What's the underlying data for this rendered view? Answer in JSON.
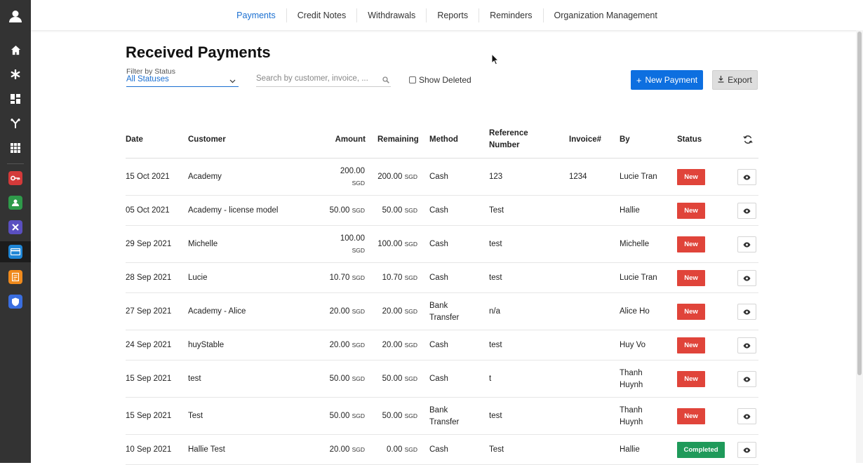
{
  "sidebar": {
    "icons": [
      "avatar-icon",
      "home-icon",
      "asterisk-icon",
      "dashboard-icon",
      "branch-icon",
      "grid-icon"
    ],
    "apps": [
      {
        "name": "key-app-icon",
        "color": "#d43a3a"
      },
      {
        "name": "people-app-icon",
        "color": "#2e9a4a"
      },
      {
        "name": "tools-app-icon",
        "color": "#5a4fc0"
      },
      {
        "name": "payment-app-icon",
        "color": "#1f86d6"
      },
      {
        "name": "notes-app-icon",
        "color": "#f08a1c"
      },
      {
        "name": "shield-app-icon",
        "color": "#3a6ee0"
      }
    ]
  },
  "nav": {
    "items": [
      "Payments",
      "Credit Notes",
      "Withdrawals",
      "Reports",
      "Reminders",
      "Organization Management"
    ],
    "active": "Payments"
  },
  "page": {
    "title": "Received Payments",
    "filter_label": "Filter by Status",
    "filter_value": "All Statuses",
    "search_placeholder": "Search by customer, invoice, ...",
    "show_deleted": "Show Deleted",
    "new_payment": "New Payment",
    "export": "Export"
  },
  "table": {
    "headers": {
      "date": "Date",
      "customer": "Customer",
      "amount": "Amount",
      "remaining": "Remaining",
      "method": "Method",
      "reference_line1": "Reference",
      "reference_line2": "Number",
      "invoice": "Invoice#",
      "by": "By",
      "status": "Status"
    },
    "currency": "SGD",
    "rows": [
      {
        "date": "15 Oct 2021",
        "customer": "Academy",
        "amount": "200.00",
        "remaining": "200.00",
        "method": [
          "Cash"
        ],
        "reference": "123",
        "invoice": "1234",
        "by": [
          "Lucie Tran"
        ],
        "status": "New",
        "amount_wrap": true
      },
      {
        "date": "05 Oct 2021",
        "customer": "Academy - license model",
        "amount": "50.00",
        "remaining": "50.00",
        "method": [
          "Cash"
        ],
        "reference": "Test",
        "invoice": "",
        "by": [
          "Hallie"
        ],
        "status": "New",
        "amount_wrap": false
      },
      {
        "date": "29 Sep 2021",
        "customer": "Michelle",
        "amount": "100.00",
        "remaining": "100.00",
        "method": [
          "Cash"
        ],
        "reference": "test",
        "invoice": "",
        "by": [
          "Michelle"
        ],
        "status": "New",
        "amount_wrap": true
      },
      {
        "date": "28 Sep 2021",
        "customer": "Lucie",
        "amount": "10.70",
        "remaining": "10.70",
        "method": [
          "Cash"
        ],
        "reference": "test",
        "invoice": "",
        "by": [
          "Lucie Tran"
        ],
        "status": "New",
        "amount_wrap": false
      },
      {
        "date": "27 Sep 2021",
        "customer": "Academy - Alice",
        "amount": "20.00",
        "remaining": "20.00",
        "method": [
          "Bank",
          "Transfer"
        ],
        "reference": "n/a",
        "invoice": "",
        "by": [
          "Alice Ho"
        ],
        "status": "New",
        "amount_wrap": false
      },
      {
        "date": "24 Sep 2021",
        "customer": "huyStable",
        "amount": "20.00",
        "remaining": "20.00",
        "method": [
          "Cash"
        ],
        "reference": "test",
        "invoice": "",
        "by": [
          "Huy Vo"
        ],
        "status": "New",
        "amount_wrap": false
      },
      {
        "date": "15 Sep 2021",
        "customer": "test",
        "amount": "50.00",
        "remaining": "50.00",
        "method": [
          "Cash"
        ],
        "reference": "t",
        "invoice": "",
        "by": [
          "Thanh",
          "Huynh"
        ],
        "status": "New",
        "amount_wrap": false
      },
      {
        "date": "15 Sep 2021",
        "customer": "Test",
        "amount": "50.00",
        "remaining": "50.00",
        "method": [
          "Bank",
          "Transfer"
        ],
        "reference": "test",
        "invoice": "",
        "by": [
          "Thanh",
          "Huynh"
        ],
        "status": "New",
        "amount_wrap": false
      },
      {
        "date": "10 Sep 2021",
        "customer": "Hallie Test",
        "amount": "20.00",
        "remaining": "0.00",
        "method": [
          "Cash"
        ],
        "reference": "Test",
        "invoice": "",
        "by": [
          "Hallie"
        ],
        "status": "Completed",
        "amount_wrap": false
      }
    ]
  },
  "colors": {
    "accent": "#1a6fd1",
    "new_badge": "#e0443a",
    "completed_badge": "#1f9a5a"
  }
}
